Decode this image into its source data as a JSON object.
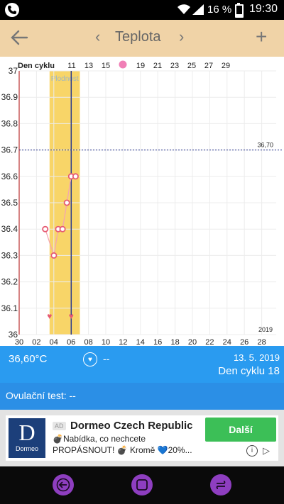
{
  "status_bar": {
    "battery_percent": "16 %",
    "time": "19:30",
    "icons": [
      "phone-icon",
      "wifi-icon",
      "signal-icon",
      "battery-icon"
    ]
  },
  "header": {
    "title": "Teplota",
    "prev_label": "‹",
    "next_label": "›",
    "add_label": "+",
    "icons": [
      "back-arrow-icon",
      "plus-icon"
    ]
  },
  "chart": {
    "top_label": "Den cyklu",
    "fertile_label": "Plodnost",
    "threshold_label": "36,70",
    "year_label": "2019"
  },
  "chart_data": {
    "type": "line",
    "title": "",
    "ylim": [
      36,
      37
    ],
    "y_ticks": [
      "37",
      "36.9",
      "36.8",
      "36.7",
      "36.6",
      "36.5",
      "36.4",
      "36.3",
      "36.2",
      "36.1",
      "36"
    ],
    "x_ticks_bottom": [
      "30",
      "02",
      "04",
      "06",
      "08",
      "10",
      "12",
      "14",
      "16",
      "18",
      "20",
      "22",
      "24",
      "26",
      "28"
    ],
    "x_ticks_top": [
      "11",
      "13",
      "15",
      "19",
      "21",
      "23",
      "25",
      "27",
      "29"
    ],
    "series": [
      {
        "dates": [
          6,
          8,
          9,
          10,
          11,
          12,
          13
        ],
        "values": [
          36.4,
          36.3,
          36.4,
          36.4,
          36.5,
          36.6,
          36.6
        ]
      }
    ],
    "threshold": 36.7,
    "fertile_window": [
      7,
      14
    ],
    "current_day": 12,
    "heart_markers": [
      7,
      12
    ],
    "grid": true,
    "colors": {
      "line": "#f4a6b0",
      "marker": "#e65a72",
      "fertile": "#f8d568",
      "threshold": "#1d2a8a",
      "today": "#2b3a8c"
    }
  },
  "readout": {
    "temperature": "36,60°C",
    "heart_value": "--",
    "date": "13. 5. 2019",
    "cycle_day": "Den cyklu 18"
  },
  "ovulation": {
    "label": "Ovulační test: --"
  },
  "ad": {
    "logo_letter": "D",
    "logo_text": "Dormeo",
    "badge": "AD",
    "name": "Dormeo Czech Republic",
    "text": "💣Nabídka, co nechcete PROPÁSNOUT! 💣 Kromě 💙20%...",
    "cta": "Další informace"
  },
  "navbar": {
    "icons": [
      "nav-back-icon",
      "nav-recents-icon",
      "nav-switch-icon"
    ],
    "color": "#8e3ec0"
  }
}
